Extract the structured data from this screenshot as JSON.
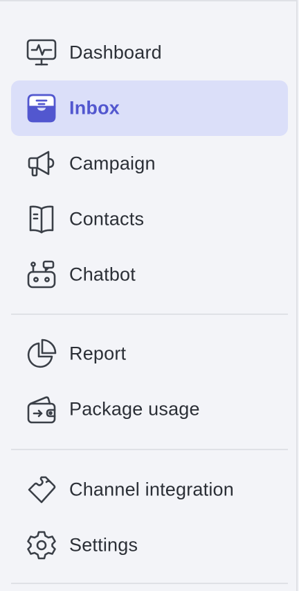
{
  "colors": {
    "background": "#f3f4f8",
    "active_bg": "#dbdff9",
    "active_text": "#5257cf",
    "text": "#2b2f36",
    "icon_stroke": "#3a3f47",
    "divider": "#dfe1e6"
  },
  "sidebar": {
    "groups": [
      {
        "items": [
          {
            "label": "Dashboard",
            "icon": "dashboard-monitor-icon",
            "active": false
          },
          {
            "label": "Inbox",
            "icon": "inbox-tray-icon",
            "active": true
          },
          {
            "label": "Campaign",
            "icon": "megaphone-icon",
            "active": false
          },
          {
            "label": "Contacts",
            "icon": "contacts-book-icon",
            "active": false
          },
          {
            "label": "Chatbot",
            "icon": "chatbot-robot-icon",
            "active": false
          }
        ]
      },
      {
        "items": [
          {
            "label": "Report",
            "icon": "pie-chart-icon",
            "active": false
          },
          {
            "label": "Package usage",
            "icon": "wallet-icon",
            "active": false
          }
        ]
      },
      {
        "items": [
          {
            "label": "Channel integration",
            "icon": "puzzle-icon",
            "active": false
          },
          {
            "label": "Settings",
            "icon": "gear-icon",
            "active": false
          }
        ]
      }
    ]
  }
}
